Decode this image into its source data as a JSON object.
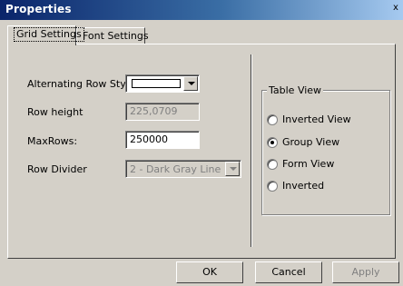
{
  "window": {
    "title": "Properties",
    "close_glyph": "x"
  },
  "tabs": [
    {
      "label": "Grid Settings",
      "active": true
    },
    {
      "label": "Font Settings",
      "active": false
    }
  ],
  "form": {
    "alternating_row_style_label": "Alternating Row Style:",
    "row_height_label": "Row height",
    "row_height_value": "225,0709",
    "max_rows_label": "MaxRows:",
    "max_rows_value": "250000",
    "row_divider_label": "Row Divider",
    "row_divider_value": "2 - Dark Gray Line"
  },
  "table_view": {
    "title": "Table View",
    "options": [
      {
        "label": "Inverted View",
        "checked": false
      },
      {
        "label": "Group View",
        "checked": true
      },
      {
        "label": "Form View",
        "checked": false
      },
      {
        "label": "Inverted",
        "checked": false
      }
    ]
  },
  "buttons": {
    "ok": "OK",
    "cancel": "Cancel",
    "apply": "Apply"
  }
}
